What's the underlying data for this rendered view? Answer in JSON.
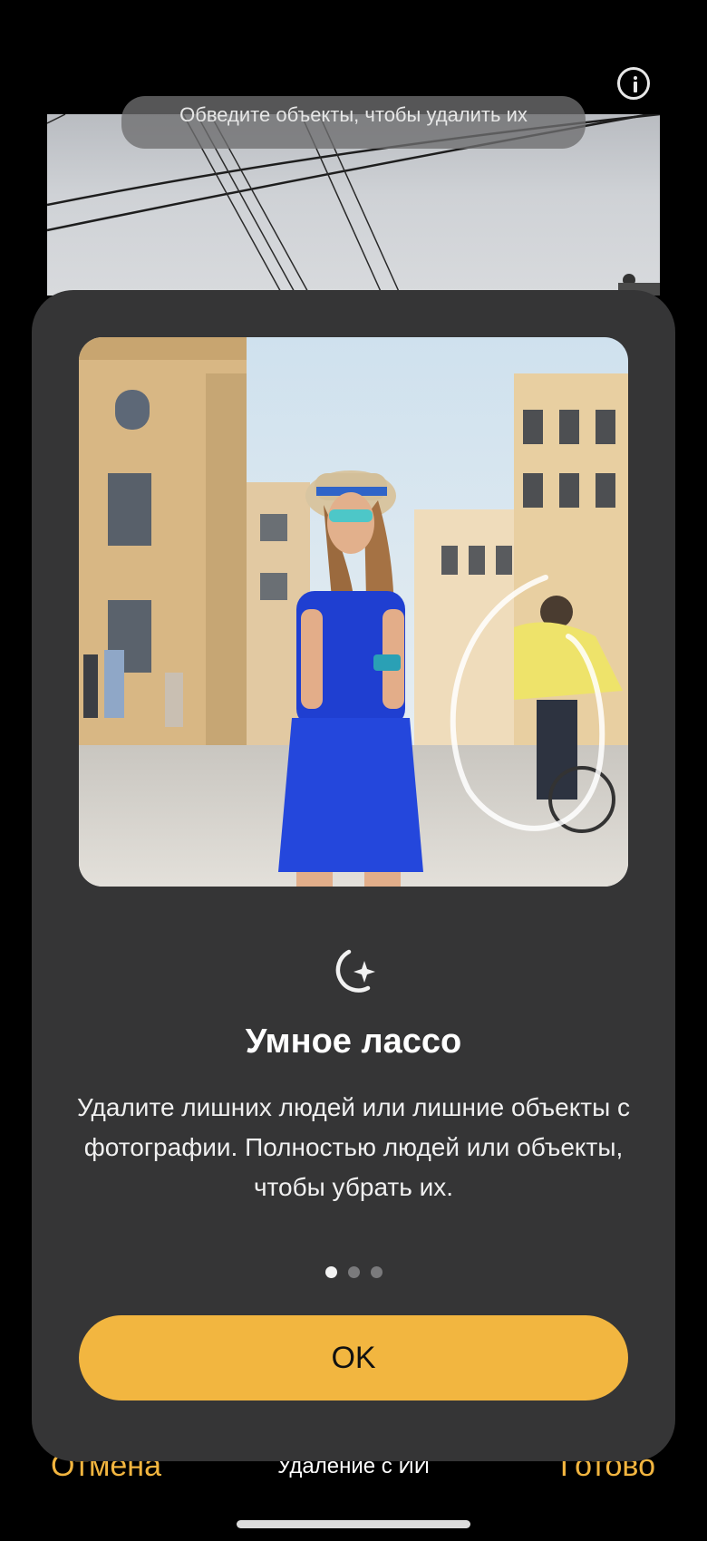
{
  "top": {
    "hint": "Обведите объекты, чтобы удалить их",
    "info_icon": "info-icon"
  },
  "onboarding": {
    "feature_icon": "sparkle-lasso-icon",
    "title": "Умное лассо",
    "description": "Удалите лишних людей или лишние объекты с фотографии. Полностью людей или объекты, чтобы убрать их.",
    "pages": 3,
    "current_page": 1,
    "ok_label": "OK"
  },
  "bottom_bar": {
    "cancel_label": "Отмена",
    "mode_label": "Удаление с ИИ",
    "done_label": "Готово"
  },
  "colors": {
    "accent": "#f2b640",
    "sheet_bg": "#353536",
    "background": "#000000"
  }
}
